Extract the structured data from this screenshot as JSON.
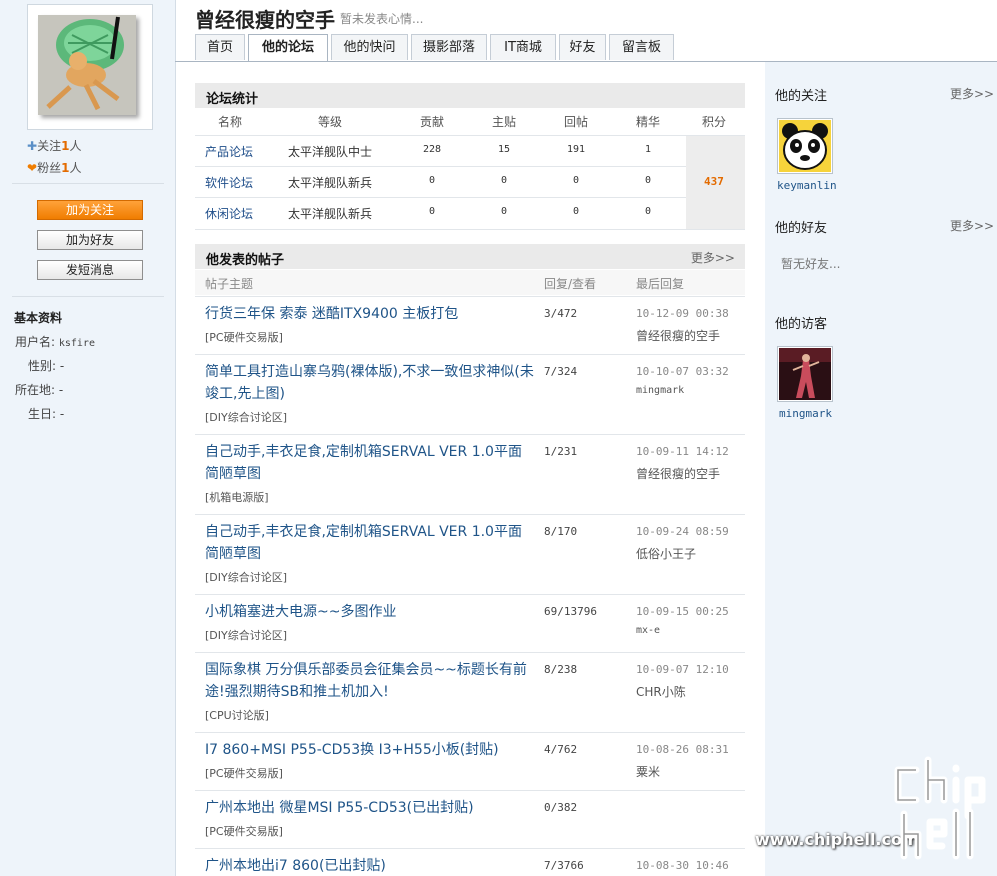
{
  "profile": {
    "name": "曾经很瘦的空手",
    "mood": "暂未发表心情...",
    "follow_label": "关注",
    "follow_count": "1",
    "fans_label": "粉丝",
    "fans_count": "1",
    "unit": "人",
    "buttons": {
      "follow": "加为关注",
      "friend": "加为好友",
      "message": "发短消息"
    }
  },
  "basic_info": {
    "title": "基本资料",
    "rows": [
      {
        "label": "用户名:",
        "value": "ksfire"
      },
      {
        "label": "性别:",
        "value": "-"
      },
      {
        "label": "所在地:",
        "value": "-"
      },
      {
        "label": "生日:",
        "value": "-"
      }
    ]
  },
  "tabs": [
    "首页",
    "他的论坛",
    "他的快问",
    "摄影部落",
    "IT商城",
    "好友",
    "留言板"
  ],
  "active_tab": "他的论坛",
  "forum_stats": {
    "title": "论坛统计",
    "headers": [
      "名称",
      "等级",
      "贡献",
      "主贴",
      "回帖",
      "精华",
      "积分"
    ],
    "rows": [
      {
        "name": "产品论坛",
        "level": "太平洋舰队中士",
        "contrib": "228",
        "topics": "15",
        "replies": "191",
        "elite": "1"
      },
      {
        "name": "软件论坛",
        "level": "太平洋舰队新兵",
        "contrib": "0",
        "topics": "0",
        "replies": "0",
        "elite": "0"
      },
      {
        "name": "休闲论坛",
        "level": "太平洋舰队新兵",
        "contrib": "0",
        "topics": "0",
        "replies": "0",
        "elite": "0"
      }
    ],
    "score": "437"
  },
  "posts": {
    "title": "他发表的帖子",
    "more": "更多>>",
    "headers": [
      "帖子主题",
      "回复/查看",
      "最后回复"
    ],
    "items": [
      {
        "title": "行货三年保 索泰 迷酷ITX9400 主板打包",
        "forum": "[PC硬件交易版]",
        "rv": "3/472",
        "time": "10-12-09 00:38",
        "user": "曾经很瘦的空手"
      },
      {
        "title": "简单工具打造山寨乌鸦(裸体版),不求一致但求神似(未竣工,先上图)",
        "forum": "[DIY综合讨论区]",
        "rv": "7/324",
        "time": "10-10-07 03:32",
        "user": "mingmark"
      },
      {
        "title": "自己动手,丰衣足食,定制机箱SERVAL VER 1.0平面简陋草图",
        "forum": "[机箱电源版]",
        "rv": "1/231",
        "time": "10-09-11 14:12",
        "user": "曾经很瘦的空手"
      },
      {
        "title": "自己动手,丰衣足食,定制机箱SERVAL VER 1.0平面简陋草图",
        "forum": "[DIY综合讨论区]",
        "rv": "8/170",
        "time": "10-09-24 08:59",
        "user": "低俗小王子"
      },
      {
        "title": "小机箱塞进大电源~~多图作业",
        "forum": "[DIY综合讨论区]",
        "rv": "69/13796",
        "time": "10-09-15 00:25",
        "user": "mx-e"
      },
      {
        "title": "国际象棋 万分俱乐部委员会征集会员~~标题长有前途!强烈期待SB和推土机加入!",
        "forum": "[CPU讨论版]",
        "rv": "8/238",
        "time": "10-09-07 12:10",
        "user": "CHR小陈"
      },
      {
        "title": "I7 860+MSI P55-CD53换 I3+H55小板(封贴)",
        "forum": "[PC硬件交易版]",
        "rv": "4/762",
        "time": "10-08-26 08:31",
        "user": "粟米"
      },
      {
        "title": "广州本地出 微星MSI P55-CD53(已出封贴)",
        "forum": "[PC硬件交易版]",
        "rv": "0/382",
        "time": "",
        "user": ""
      },
      {
        "title": "广州本地出i7 860(已出封贴)",
        "forum": "",
        "rv": "7/3766",
        "time": "10-08-30 10:46",
        "user": ""
      }
    ]
  },
  "sidebar": {
    "following_title": "他的关注",
    "friends_title": "他的好友",
    "visitors_title": "他的访客",
    "more": "更多>>",
    "following_user": "keymanlin",
    "no_friends": "暂无好友...",
    "visitor_user": "mingmark"
  },
  "watermark": {
    "url": "www.chiphell.com",
    "logo": "chiphell"
  },
  "colors": {
    "accent_orange": "#f07d00",
    "link_blue": "#1f5488",
    "sidebar_bg": "#eef4fa"
  }
}
